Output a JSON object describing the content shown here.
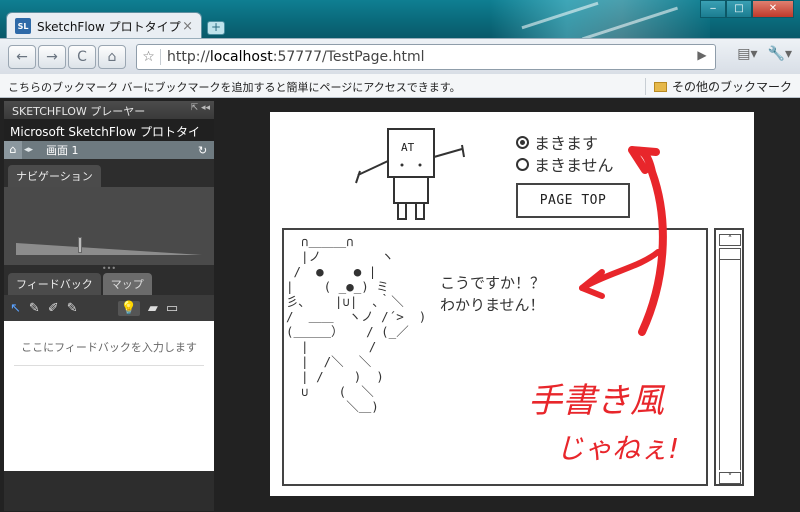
{
  "browser": {
    "tab_title": "SketchFlow プロトタイプ",
    "tab_icon_text": "SL",
    "tab_close": "×",
    "new_tab": "+",
    "window_buttons": {
      "minimize": "‒",
      "maximize": "□",
      "close": "✕"
    },
    "nav": {
      "back": "←",
      "forward": "→",
      "reload": "C",
      "home": "⌂",
      "star": "☆",
      "go": "▶"
    },
    "url_prefix": "http://",
    "url_host": "localhost",
    "url_rest": ":57777/TestPage.html",
    "tools": {
      "page": "▤▾",
      "wrench": "🔧▾"
    }
  },
  "bookmarks_bar": {
    "message": "こちらのブックマーク バーにブックマークを追加すると簡単にページにアクセスできます。",
    "other_label": "その他のブックマーク"
  },
  "player": {
    "header": "SKETCHFLOW プレーヤー",
    "header_controls": "⇱ ◂◂",
    "project_title": "Microsoft SketchFlow プロトタイプ",
    "home_icon": "⌂",
    "arrows": "◂▸",
    "screen_name": "画面 1",
    "refresh_icon": "↻",
    "navigation_tab": "ナビゲーション",
    "splitter_grip": "•••",
    "feedback_tab": "フィードバック",
    "map_tab": "マップ",
    "feedback_tools": {
      "select": "↖",
      "pen1": "✎",
      "pen2": "✐",
      "pen3": "✎",
      "bulb": "💡",
      "comment": "▰",
      "folder": "▭"
    },
    "feedback_placeholder": "ここにフィードバックを入力します"
  },
  "sketch": {
    "robot_label": "AT",
    "radio_options": [
      {
        "label": "まきます",
        "selected": true
      },
      {
        "label": "まきません",
        "selected": false
      }
    ],
    "page_top_button": "PAGE TOP",
    "speech_line1": "こうですか！？",
    "speech_line2": "わかりません！",
    "handwriting_line1": "手書き風",
    "handwriting_line2": "じゃねぇ!",
    "scroll_up": "˄",
    "scroll_down": "˅",
    "ascii_art": "  ∩＿＿＿∩\n  |ノ        ヽ\n /  ●    ● |\n|    ( _●_) ミ\n彡､    |∪|  ､｀＼\n/  ＿＿  ヽノ /´>  )\n(＿＿＿）   / (_／\n  |        /\n  |  /＼  ＼\n  | /    )  )\n  ∪    (  ＼\n        ＼＿)"
  },
  "colors": {
    "accent_red": "#e8262b",
    "title_bar": "#0f7f92",
    "player_bg": "#2d2d2d"
  }
}
